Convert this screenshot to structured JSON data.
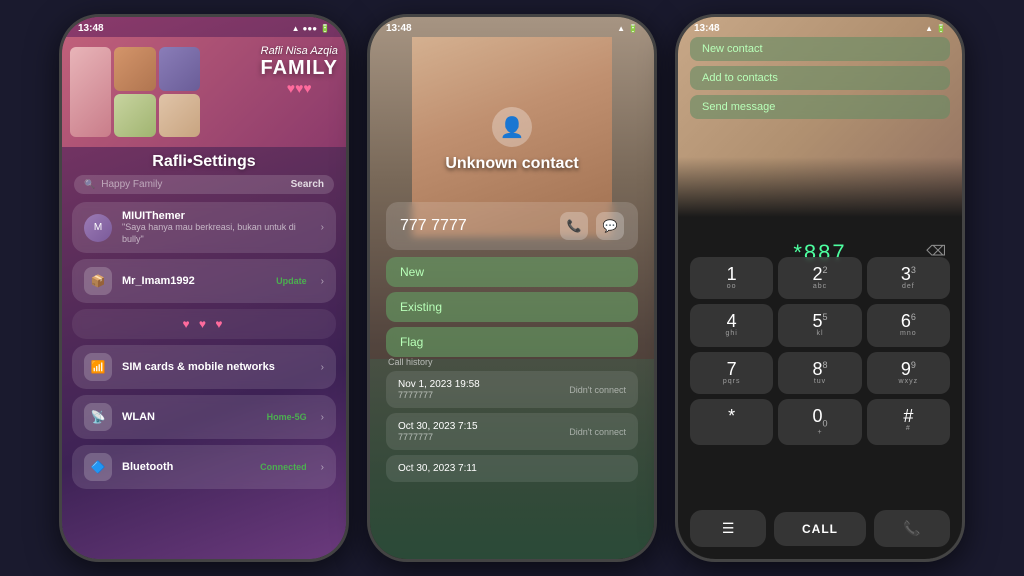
{
  "phones": {
    "phone1": {
      "status_time": "13:48",
      "header": {
        "cursive_title": "Rafli Nisa Azqia",
        "family_label": "FAMILY",
        "hearts": "♥♥♥"
      },
      "title": "Rafli•Settings",
      "search": {
        "placeholder": "Happy Family",
        "button": "Search"
      },
      "items": [
        {
          "id": "miuithemer",
          "title": "MIUIThemer",
          "subtitle": "\"Saya hanya mau berkreasi, bukan untuk di bully\"",
          "has_arrow": true,
          "type": "avatar"
        },
        {
          "id": "mr-imam",
          "title": "Mr_Imam1992",
          "badge": "Update",
          "has_arrow": true,
          "type": "icon",
          "icon": "📦"
        },
        {
          "id": "hearts",
          "hearts": "♥ ♥ ♥",
          "type": "hearts"
        },
        {
          "id": "sim-cards",
          "title": "SIM cards & mobile networks",
          "has_arrow": true,
          "type": "icon",
          "icon": "📶"
        },
        {
          "id": "wlan",
          "title": "WLAN",
          "badge": "Home-5G",
          "has_arrow": true,
          "type": "icon",
          "icon": "📡"
        },
        {
          "id": "bluetooth",
          "title": "Bluetooth",
          "badge": "Connected",
          "has_arrow": true,
          "type": "icon",
          "icon": "🔷"
        }
      ]
    },
    "phone2": {
      "status_time": "13:48",
      "unknown_contact": "Unknown contact",
      "phone_number": "777 7777",
      "options": [
        "New",
        "Existing",
        "Flag"
      ],
      "call_history_label": "Call history",
      "history": [
        {
          "date": "Nov 1, 2023 19:58",
          "number": "7777777",
          "type": "Didn't connect"
        },
        {
          "date": "Oct 30, 2023 7:15",
          "number": "7777777",
          "type": "Didn't connect"
        },
        {
          "date": "Oct 30, 2023 7:11",
          "number": "",
          "type": ""
        }
      ]
    },
    "phone3": {
      "status_time": "13:48",
      "options": [
        "New contact",
        "Add to contacts",
        "Send message"
      ],
      "dialer_number": "*887",
      "keys": [
        {
          "main": "1",
          "sub": "oo"
        },
        {
          "main": "2",
          "sub": "abc"
        },
        {
          "main": "3",
          "sub": "def"
        },
        {
          "main": "4",
          "sub": "ghi"
        },
        {
          "main": "5",
          "sub": "5kl"
        },
        {
          "main": "6",
          "sub": "mno"
        },
        {
          "main": "7",
          "sub": "pqrs"
        },
        {
          "main": "8",
          "sub": "8tuv"
        },
        {
          "main": "9",
          "sub": "wxyz"
        },
        {
          "main": "*",
          "sub": ""
        },
        {
          "main": "0",
          "sub": "+"
        },
        {
          "main": "#",
          "sub": "#"
        }
      ],
      "call_button": "CALL"
    }
  }
}
